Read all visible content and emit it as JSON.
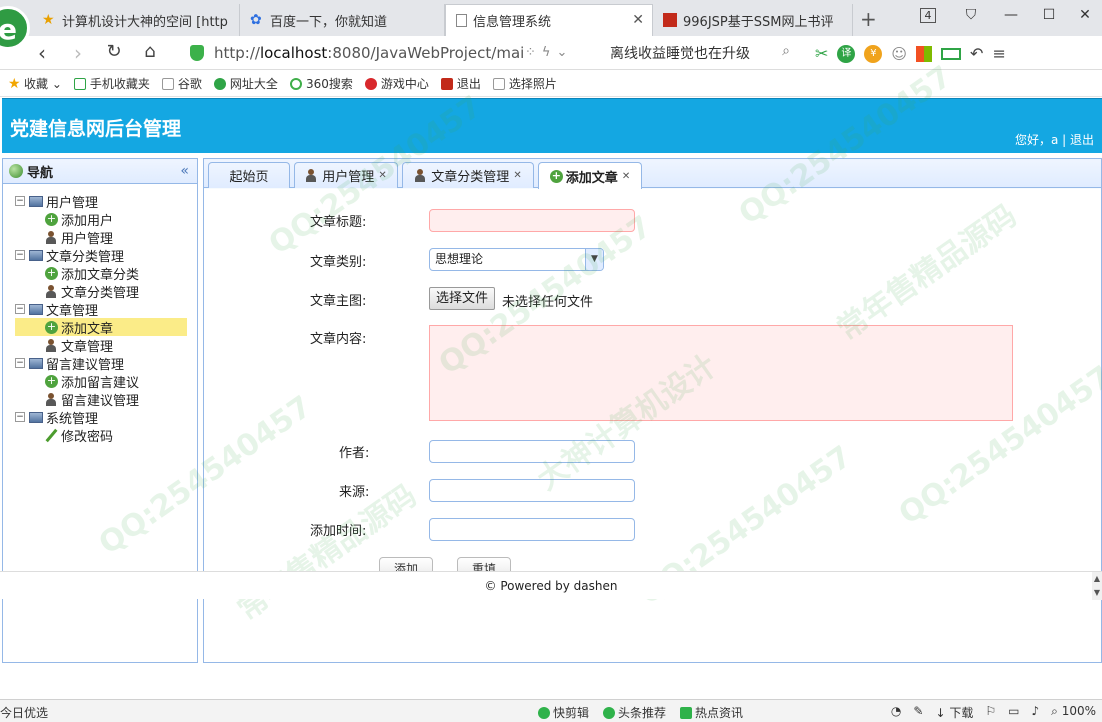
{
  "browser": {
    "tabs": [
      {
        "title": "计算机设计大神的空间 [http"
      },
      {
        "title": "百度一下，你就知道"
      },
      {
        "title": "信息管理系统"
      },
      {
        "title": "996JSP基于SSM网上书评"
      }
    ],
    "tab_count": "4",
    "url_prefix": "http://",
    "url_host": "localhost",
    "url_rest": ":8080/JavaWebProject/mai",
    "search_text": "离线收益睡觉也在升级",
    "bookmarks": [
      "收藏",
      "手机收藏夹",
      "谷歌",
      "网址大全",
      "360搜索",
      "游戏中心",
      "退出",
      "选择照片"
    ],
    "ext_label": "译"
  },
  "site": {
    "title": "党建信息网后台管理",
    "greeting": "您好，a",
    "separator": " | ",
    "logout": "退出"
  },
  "nav": {
    "title": "导航",
    "collapse": "«",
    "groups": [
      {
        "label": "用户管理",
        "items": [
          {
            "label": "添加用户",
            "icon": "add"
          },
          {
            "label": "用户管理",
            "icon": "user"
          }
        ]
      },
      {
        "label": "文章分类管理",
        "items": [
          {
            "label": "添加文章分类",
            "icon": "add"
          },
          {
            "label": "文章分类管理",
            "icon": "user"
          }
        ]
      },
      {
        "label": "文章管理",
        "items": [
          {
            "label": "添加文章",
            "icon": "add",
            "selected": true
          },
          {
            "label": "文章管理",
            "icon": "user"
          }
        ]
      },
      {
        "label": "留言建议管理",
        "items": [
          {
            "label": "添加留言建议",
            "icon": "add"
          },
          {
            "label": "留言建议管理",
            "icon": "user"
          }
        ]
      },
      {
        "label": "系统管理",
        "items": [
          {
            "label": "修改密码",
            "icon": "pencil"
          }
        ]
      }
    ]
  },
  "content_tabs": [
    {
      "label": "起始页"
    },
    {
      "label": "用户管理"
    },
    {
      "label": "文章分类管理"
    },
    {
      "label": "添加文章"
    }
  ],
  "form": {
    "title_label": "文章标题:",
    "title_value": "",
    "category_label": "文章类别:",
    "category_value": "思想理论",
    "image_label": "文章主图:",
    "file_button": "选择文件",
    "file_status": "未选择任何文件",
    "content_label": "文章内容:",
    "content_value": "",
    "author_label": "作者:",
    "author_value": "",
    "source_label": "来源:",
    "source_value": "",
    "time_label": "添加时间:",
    "time_value": "",
    "submit_button": "添加",
    "reset_button": "重填"
  },
  "footer": {
    "text": "© Powered by dashen"
  },
  "statusbar": {
    "left": "今日优选",
    "items": [
      "快剪辑",
      "头条推荐",
      "热点资讯"
    ],
    "download": "下载",
    "zoom": "100%"
  },
  "watermark": [
    "QQ:254540457",
    "常年售精品源码",
    "大神计算机设计"
  ],
  "colors": {
    "header": "#14a7e2",
    "panel_border": "#95b8e7",
    "selected": "#fbec88",
    "invalid_field": "#ffeeee"
  }
}
